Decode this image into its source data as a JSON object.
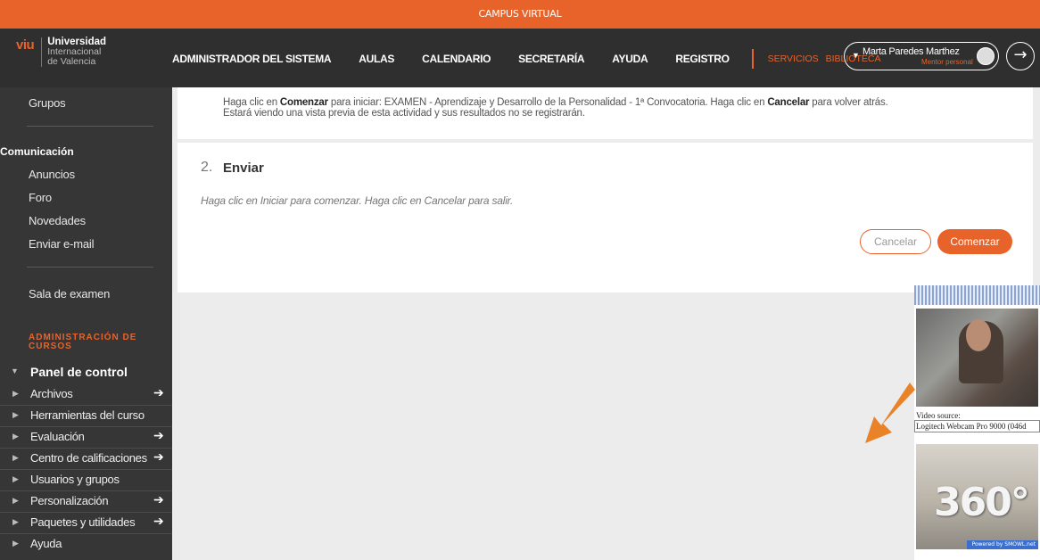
{
  "topbar": {
    "title": "CAMPUS VIRTUAL"
  },
  "logo": {
    "brand": "viu",
    "line1": "Universidad",
    "line2": "Internacional",
    "line3": "de Valencia"
  },
  "nav": {
    "items": [
      "ADMINISTRADOR DEL SISTEMA",
      "AULAS",
      "CALENDARIO",
      "SECRETARÍA",
      "AYUDA",
      "REGISTRO"
    ],
    "extra": [
      "SERVICIOS",
      "BIBLIOTECA"
    ]
  },
  "user": {
    "name": "Marta Paredes Marthez",
    "sub": "Mentor personal",
    "logout_icon": "logout-icon"
  },
  "sidebar": {
    "grupos": "Grupos",
    "comunicacion": "Comunicación",
    "comm_items": [
      "Anuncios",
      "Foro",
      "Novedades",
      "Enviar e-mail"
    ],
    "sala": "Sala de examen",
    "admin_title": "ADMINISTRACIÓN DE CURSOS",
    "panel": "Panel de control",
    "tools": [
      {
        "label": "Archivos",
        "arrow": true
      },
      {
        "label": "Herramientas del curso",
        "arrow": false
      },
      {
        "label": "Evaluación",
        "arrow": true
      },
      {
        "label": "Centro de calificaciones",
        "arrow": true
      },
      {
        "label": "Usuarios y grupos",
        "arrow": false
      },
      {
        "label": "Personalización",
        "arrow": true
      },
      {
        "label": "Paquetes y utilidades",
        "arrow": true
      },
      {
        "label": "Ayuda",
        "arrow": false
      }
    ]
  },
  "step1": {
    "pre": "Haga clic en ",
    "comenzar": "Comenzar",
    "mid": " para iniciar: EXAMEN - Aprendizaje y Desarrollo de la Personalidad - 1ª Convocatoria. Haga clic en ",
    "cancelar": "Cancelar",
    "post": " para volver atrás.",
    "line2": "Estará viendo una vista previa de esta actividad y sus resultados no se registrarán."
  },
  "step2": {
    "number": "2.",
    "title": "Enviar",
    "desc": "Haga clic en Iniciar para comenzar. Haga clic en Cancelar para salir.",
    "cancel_label": "Cancelar",
    "start_label": "Comenzar"
  },
  "webcam": {
    "source_label": "Video source:",
    "device": "Logitech Webcam Pro 9000 (046d",
    "overlay": "360°",
    "powered": "Powered by SMOWL.net"
  },
  "colors": {
    "accent": "#e8632a",
    "sidebar": "#363636",
    "header": "#2f2f2f"
  }
}
